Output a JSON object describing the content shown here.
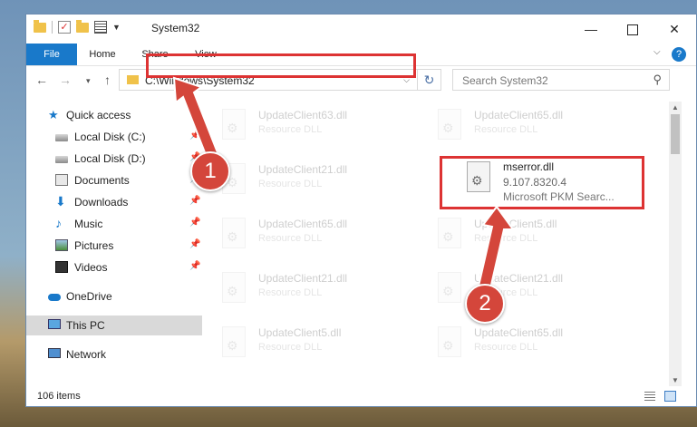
{
  "window": {
    "title": "System32",
    "minimize_glyph": "—",
    "close_glyph": "✕"
  },
  "ribbon": {
    "tabs": [
      {
        "label": "File"
      },
      {
        "label": "Home"
      },
      {
        "label": "Share"
      },
      {
        "label": "View"
      }
    ],
    "help_glyph": "?",
    "chevron_glyph": "⌵"
  },
  "navbar": {
    "back_glyph": "←",
    "forward_glyph": "→",
    "recent_glyph": "▾",
    "up_glyph": "↑",
    "address_path": "C:\\Windows\\System32",
    "address_dropdown_glyph": "⌵",
    "refresh_glyph": "↻",
    "search_placeholder": "Search System32",
    "search_glyph": "⚲"
  },
  "sidebar": {
    "items": [
      {
        "label": "Quick access",
        "icon": "star-icon",
        "pinned": false
      },
      {
        "label": "Local Disk (C:)",
        "icon": "drive-icon",
        "pinned": true
      },
      {
        "label": "Local Disk (D:)",
        "icon": "drive-icon",
        "pinned": true
      },
      {
        "label": "Documents",
        "icon": "documents-icon",
        "pinned": true
      },
      {
        "label": "Downloads",
        "icon": "download-icon",
        "pinned": true
      },
      {
        "label": "Music",
        "icon": "music-icon",
        "pinned": true
      },
      {
        "label": "Pictures",
        "icon": "pictures-icon",
        "pinned": true
      },
      {
        "label": "Videos",
        "icon": "videos-icon",
        "pinned": true
      },
      {
        "label": "OneDrive",
        "icon": "cloud-icon",
        "pinned": false
      },
      {
        "label": "This PC",
        "icon": "computer-icon",
        "pinned": false,
        "selected": true
      },
      {
        "label": "Network",
        "icon": "network-icon",
        "pinned": false
      }
    ],
    "pin_glyph": "📌"
  },
  "files": [
    {
      "name": "UpdateClient63.dll",
      "type": "Resource DLL"
    },
    {
      "name": "UpdateClient65.dll",
      "type": "Resource DLL"
    },
    {
      "name": "UpdateClient21.dll",
      "type": "Resource DLL"
    },
    {
      "name": "mserror.dll",
      "version": "9.107.8320.4",
      "description": "Microsoft PKM Searc...",
      "highlighted": true
    },
    {
      "name": "UpdateClient65.dll",
      "type": "Resource DLL"
    },
    {
      "name": "UpdateClient5.dll",
      "type": "Resource DLL"
    },
    {
      "name": "UpdateClient21.dll",
      "type": "Resource DLL"
    },
    {
      "name": "UpdateClient21.dll",
      "type": "Resource DLL"
    },
    {
      "name": "UpdateClient5.dll",
      "type": "Resource DLL"
    },
    {
      "name": "UpdateClient65.dll",
      "type": "Resource DLL"
    }
  ],
  "status": {
    "item_count": "106 items"
  },
  "annotations": {
    "step1": "1",
    "step2": "2",
    "color": "#d4463b"
  }
}
